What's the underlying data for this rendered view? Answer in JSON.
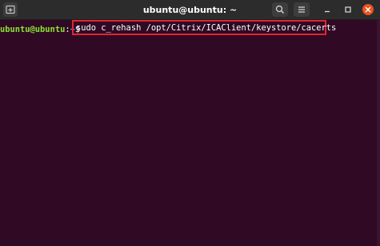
{
  "window": {
    "title": "ubuntu@ubuntu: ~"
  },
  "titlebar": {
    "icons": {
      "new_tab": "new-tab-icon",
      "search": "search-icon",
      "menu": "hamburger-menu-icon",
      "minimize": "minimize-icon",
      "maximize": "maximize-icon",
      "close": "close-icon"
    }
  },
  "terminal": {
    "prompt_user": "ubuntu@ubuntu",
    "prompt_sep": ":",
    "prompt_path": "~",
    "prompt_dollar": "$",
    "command": "sudo c_rehash /opt/Citrix/ICAClient/keystore/cacerts"
  },
  "colors": {
    "background": "#300a24",
    "titlebar": "#2c2c2c",
    "prompt_user": "#8ae234",
    "prompt_path": "#729fcf",
    "highlight_border": "#e0262f",
    "close_button": "#e95420"
  }
}
